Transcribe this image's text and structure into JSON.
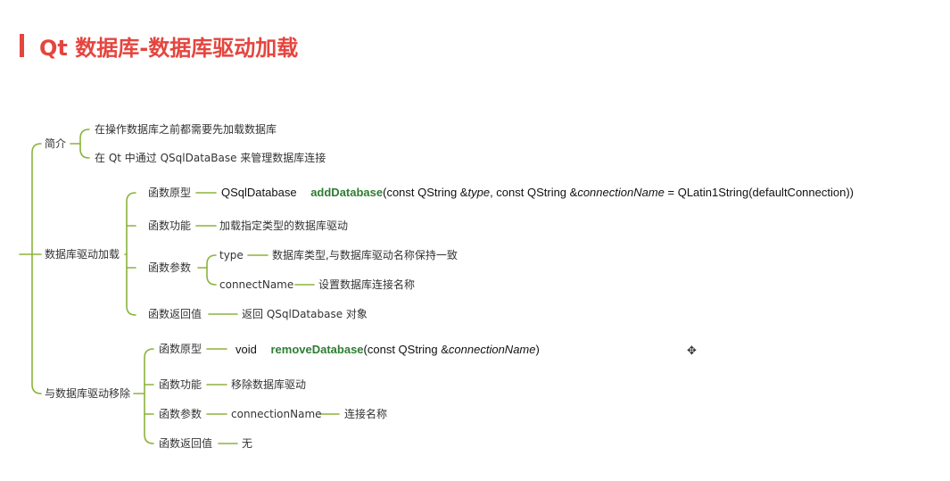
{
  "title": "Qt 数据库-数据库驱动加载",
  "branches": {
    "intro": {
      "label": "简介",
      "items": [
        "在操作数据库之前都需要先加载数据库",
        "在 Qt 中通过 QSqlDataBase  来管理数据库连接"
      ]
    },
    "load": {
      "label": "数据库驱动加载",
      "proto_label": "函数原型",
      "proto": {
        "ret": "QSqlDatabase",
        "name": "addDatabase",
        "p1": "(const QString &",
        "p1_name": "type",
        "p2": ", const QString &",
        "p2_name": "connectionName",
        "p3": " = QLatin1String(defaultConnection))"
      },
      "func_label": "函数功能",
      "func_text": "加载指定类型的数据库驱动",
      "params_label": "函数参数",
      "params": [
        {
          "name": "type",
          "desc": "数据库类型,与数据库驱动名称保持一致"
        },
        {
          "name": "connectName",
          "desc": "设置数据库连接名称"
        }
      ],
      "ret_label": "函数返回值",
      "ret_text": "返回 QSqlDatabase 对象"
    },
    "remove": {
      "label": "与数据库驱动移除",
      "proto_label": "函数原型",
      "proto": {
        "ret": "void",
        "name": "removeDatabase",
        "p1": "(const QString &",
        "p1_name": "connectionName",
        "p2": ")"
      },
      "func_label": "函数功能",
      "func_text": "移除数据库驱动",
      "params_label": "函数参数",
      "param_name": "connectionName",
      "param_desc": "连接名称",
      "ret_label": "函数返回值",
      "ret_text": "无"
    }
  },
  "colors": {
    "accent": "#e5453f",
    "line": "#8bb33c",
    "function": "#2e7d32"
  }
}
